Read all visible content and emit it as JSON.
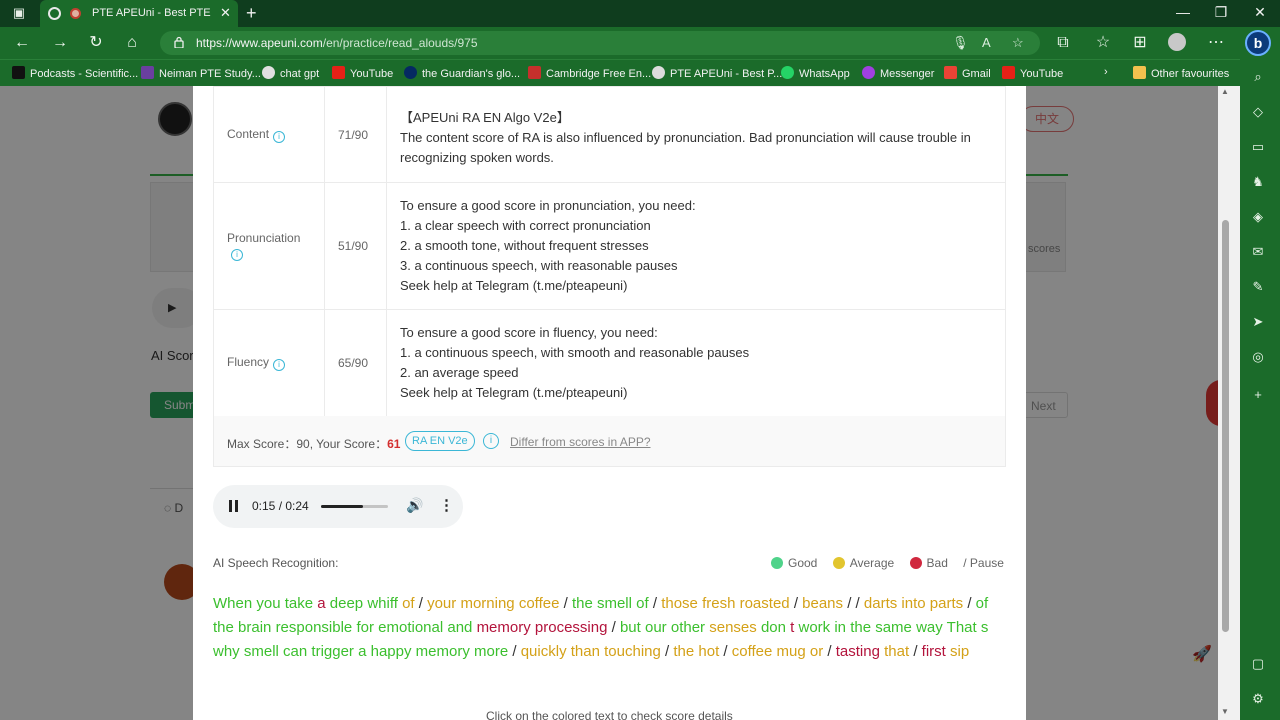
{
  "browser": {
    "tab_title": "PTE APEUni - Best PTE Test P",
    "url_domain": "https://www.apeuni.com",
    "url_path": "/en/practice/read_alouds/975",
    "bookmarks": [
      {
        "label": "Podcasts - Scientific..."
      },
      {
        "label": "Neiman PTE Study..."
      },
      {
        "label": "chat gpt"
      },
      {
        "label": "YouTube"
      },
      {
        "label": "the Guardian's glo..."
      },
      {
        "label": "Cambridge Free En..."
      },
      {
        "label": "PTE APEUni - Best P..."
      },
      {
        "label": "WhatsApp"
      },
      {
        "label": "Messenger"
      },
      {
        "label": "Gmail"
      },
      {
        "label": "YouTube"
      }
    ],
    "other_favourites": "Other favourites"
  },
  "background": {
    "lang_button": "中文",
    "scores_hint": "scores",
    "ai_score_label": "AI Scor",
    "submit_label": "Subm",
    "next_label": "Next",
    "discussion_label": "D"
  },
  "score_table": {
    "rows": [
      {
        "name": "Content",
        "score": "71/90",
        "lines": [
          "【APEUni RA EN Algo V2e】",
          "The content score of RA is also influenced by pronunciation. Bad pronunciation will cause trouble in",
          "recognizing spoken words."
        ]
      },
      {
        "name": "Pronunciation",
        "score": "51/90",
        "lines": [
          "To ensure a good score in pronunciation, you need:",
          "1. a clear speech with correct pronunciation",
          "2. a smooth tone, without frequent stresses",
          "3. a continuous speech, with reasonable pauses",
          "Seek help at Telegram (t.me/pteapeuni)"
        ]
      },
      {
        "name": "Fluency",
        "score": "65/90",
        "lines": [
          "To ensure a good score in fluency, you need:",
          "1. a continuous speech, with smooth and reasonable pauses",
          "2. an average speed",
          "Seek help at Telegram (t.me/pteapeuni)"
        ]
      }
    ],
    "summary": {
      "max_label": "Max Score：90,  Your Score：",
      "your_score": "61",
      "algo_badge": "RA EN V2e",
      "differ_link": "Differ from scores in APP?"
    }
  },
  "audio": {
    "time": "0:15 / 0:24",
    "progress": 0.625
  },
  "asr": {
    "label": "AI Speech Recognition:",
    "legend": {
      "good": "Good",
      "average": "Average",
      "bad": "Bad",
      "pause": "/ Pause"
    },
    "colors": {
      "good": "#3bbf2e",
      "average": "#d4a118",
      "bad": "#b3143c"
    },
    "tokens": [
      {
        "t": "When",
        "c": "good"
      },
      {
        "t": "you",
        "c": "good"
      },
      {
        "t": "take",
        "c": "good"
      },
      {
        "t": "a",
        "c": "bad"
      },
      {
        "t": "deep",
        "c": "good"
      },
      {
        "t": "whiff",
        "c": "good"
      },
      {
        "t": "of",
        "c": "avg"
      },
      {
        "t": "/",
        "c": "pause"
      },
      {
        "t": "your",
        "c": "avg"
      },
      {
        "t": "morning",
        "c": "avg"
      },
      {
        "t": "coffee",
        "c": "avg"
      },
      {
        "t": "/",
        "c": "pause"
      },
      {
        "t": "the",
        "c": "good"
      },
      {
        "t": "smell",
        "c": "good"
      },
      {
        "t": "of",
        "c": "good"
      },
      {
        "t": "/",
        "c": "pause"
      },
      {
        "t": "those",
        "c": "avg"
      },
      {
        "t": "fresh",
        "c": "avg"
      },
      {
        "t": "roasted",
        "c": "avg"
      },
      {
        "t": "/",
        "c": "pause"
      },
      {
        "t": "beans",
        "c": "avg"
      },
      {
        "t": "/",
        "c": "pause"
      },
      {
        "t": "/",
        "c": "pause"
      },
      {
        "t": "darts",
        "c": "avg"
      },
      {
        "t": "into",
        "c": "avg"
      },
      {
        "t": "parts",
        "c": "avg"
      },
      {
        "t": "/",
        "c": "pause"
      },
      {
        "t": "of",
        "c": "good"
      },
      {
        "t": "the",
        "c": "good"
      },
      {
        "t": "brain",
        "c": "good"
      },
      {
        "t": "responsible",
        "c": "good"
      },
      {
        "t": "for",
        "c": "good"
      },
      {
        "t": "emotional",
        "c": "good"
      },
      {
        "t": "and",
        "c": "good"
      },
      {
        "t": "memory",
        "c": "bad"
      },
      {
        "t": "processing",
        "c": "bad"
      },
      {
        "t": "/",
        "c": "pause"
      },
      {
        "t": "but",
        "c": "good"
      },
      {
        "t": "our",
        "c": "good"
      },
      {
        "t": "other",
        "c": "good"
      },
      {
        "t": "senses",
        "c": "avg"
      },
      {
        "t": "don",
        "c": "good"
      },
      {
        "t": "t",
        "c": "bad"
      },
      {
        "t": "work",
        "c": "good"
      },
      {
        "t": "in",
        "c": "good"
      },
      {
        "t": "the",
        "c": "good"
      },
      {
        "t": "same",
        "c": "good"
      },
      {
        "t": "way",
        "c": "good"
      },
      {
        "t": "That",
        "c": "good"
      },
      {
        "t": "s",
        "c": "good"
      },
      {
        "t": "why",
        "c": "good"
      },
      {
        "t": "smell",
        "c": "good"
      },
      {
        "t": "can",
        "c": "good"
      },
      {
        "t": "trigger",
        "c": "good"
      },
      {
        "t": "a",
        "c": "good"
      },
      {
        "t": "happy",
        "c": "good"
      },
      {
        "t": "memory",
        "c": "good"
      },
      {
        "t": "more",
        "c": "good"
      },
      {
        "t": "/",
        "c": "pause"
      },
      {
        "t": "quickly",
        "c": "avg"
      },
      {
        "t": "than",
        "c": "avg"
      },
      {
        "t": "touching",
        "c": "avg"
      },
      {
        "t": "/",
        "c": "pause"
      },
      {
        "t": "the",
        "c": "avg"
      },
      {
        "t": "hot",
        "c": "avg"
      },
      {
        "t": "/",
        "c": "pause"
      },
      {
        "t": "coffee",
        "c": "avg"
      },
      {
        "t": "mug",
        "c": "avg"
      },
      {
        "t": "or",
        "c": "avg"
      },
      {
        "t": "/",
        "c": "pause"
      },
      {
        "t": "tasting",
        "c": "bad"
      },
      {
        "t": "that",
        "c": "avg"
      },
      {
        "t": "/",
        "c": "pause"
      },
      {
        "t": "first",
        "c": "bad"
      },
      {
        "t": "sip",
        "c": "avg"
      }
    ],
    "footer": "Click on the colored text to check score details"
  }
}
